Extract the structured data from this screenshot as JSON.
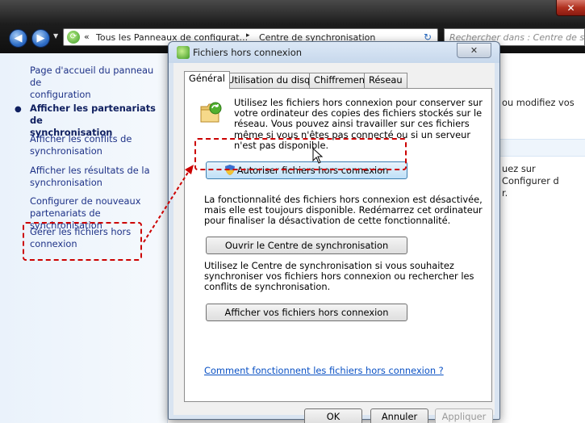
{
  "window": {
    "close_glyph": "✕",
    "address": {
      "chevron": "«",
      "crumb1": "Tous les Panneaux de configurat...",
      "separator": "▸",
      "crumb2": "Centre de synchronisation"
    },
    "search_placeholder": "Rechercher dans : Centre de syn"
  },
  "sidebar": {
    "items": [
      {
        "label_line1": "Page d'accueil du panneau de",
        "label_line2": "configuration",
        "current": false
      },
      {
        "label_line1": "Afficher les partenariats de",
        "label_line2": "synchronisation",
        "current": true
      },
      {
        "label_line1": "Afficher les conflits de",
        "label_line2": "synchronisation",
        "current": false
      },
      {
        "label_line1": "Afficher les résultats de la",
        "label_line2": "synchronisation",
        "current": false
      },
      {
        "label_line1": "Configurer de nouveaux",
        "label_line2": "partenariats de synchronisation",
        "current": false
      },
      {
        "label_line1": "Gérer les fichiers hors",
        "label_line2": "connexion",
        "current": false
      }
    ]
  },
  "main": {
    "fragment1": "ou modifiez vos",
    "fragment2_line1": "uez sur Configurer d",
    "fragment2_line2": "r."
  },
  "dialog": {
    "title": "Fichiers hors connexion",
    "tabs": [
      "Général",
      "Utilisation du disque",
      "Chiffrement",
      "Réseau"
    ],
    "intro": "Utilisez les fichiers hors connexion pour conserver sur votre ordinateur des copies des fichiers stockés sur le réseau. Vous pouvez ainsi travailler sur ces fichiers même si vous n'êtes pas connecté ou si un serveur n'est pas disponible.",
    "enable_button": "Autoriser fichiers hors connexion",
    "disabled_text": "La fonctionnalité des fichiers hors connexion est désactivée, mais elle est toujours disponible. Redémarrez cet ordinateur pour finaliser la désactivation de cette fonctionnalité.",
    "open_sync_button": "Ouvrir le Centre de synchronisation",
    "sync_text": "Utilisez le Centre de synchronisation si vous souhaitez synchroniser vos fichiers hors connexion ou rechercher les conflits de synchronisation.",
    "view_files_button": "Afficher vos fichiers hors connexion",
    "help_link": "Comment fonctionnent les fichiers hors connexion ?",
    "ok_button": "OK",
    "cancel_button": "Annuler",
    "apply_button": "Appliquer"
  },
  "colors": {
    "highlight": "#cc0000",
    "link": "#1e3287"
  }
}
